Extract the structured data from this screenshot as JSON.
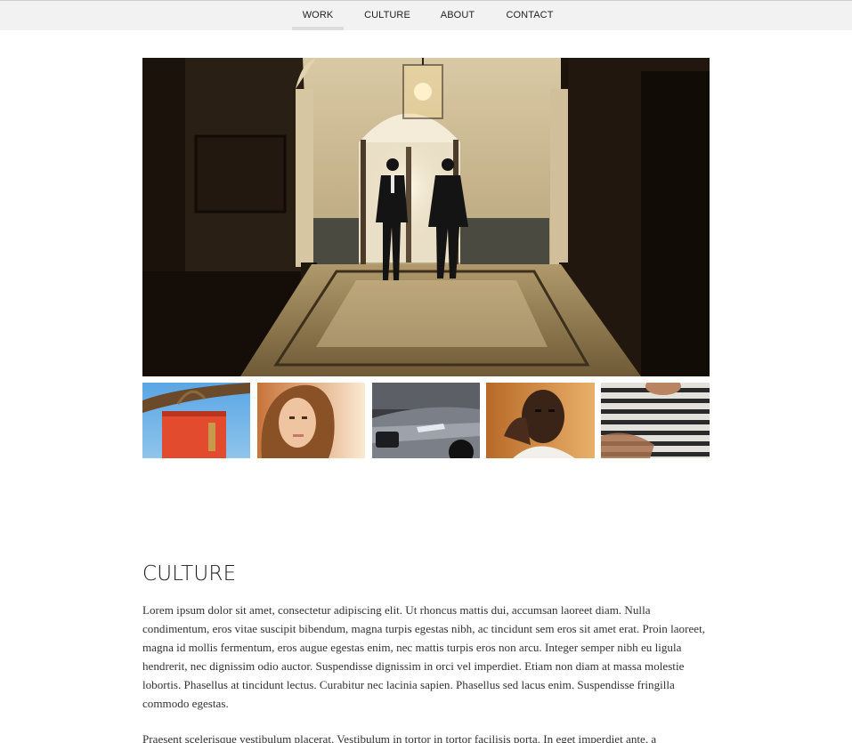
{
  "nav": {
    "items": [
      {
        "label": "WORK",
        "active": true
      },
      {
        "label": "CULTURE",
        "active": false
      },
      {
        "label": "ABOUT",
        "active": false
      },
      {
        "label": "CONTACT",
        "active": false
      }
    ]
  },
  "gallery": {
    "hero": {
      "subject": "two men in suits walking down a lit hallway"
    },
    "thumbnails": [
      {
        "subject": "red handbag hanging from tree branch"
      },
      {
        "subject": "woman with long hair in sunlight"
      },
      {
        "subject": "front of grey car"
      },
      {
        "subject": "man resting head on hand"
      },
      {
        "subject": "person in striped t-shirt"
      }
    ]
  },
  "culture": {
    "heading": "CULTURE",
    "paragraphs": [
      "Lorem ipsum dolor sit amet, consectetur adipiscing elit. Ut rhoncus mattis dui, accumsan laoreet diam. Nulla condimentum, eros vitae suscipit bibendum, magna turpis egestas nibh, ac tincidunt sem eros sit amet erat. Proin laoreet, magna id mollis fermentum, eros augue egestas enim, nec mattis turpis eros non arcu. Integer semper nibh eu ligula hendrerit, nec dignissim odio auctor. Suspendisse dignissim in orci vel imperdiet. Etiam non diam at massa molestie lobortis. Phasellus at tincidunt lectus. Curabitur nec lacinia sapien. Phasellus sed lacus enim. Suspendisse fringilla commodo egestas.",
      "Praesent scelerisque vestibulum placerat. Vestibulum in tortor in tortor facilisis porta. In eget imperdiet ante, a"
    ]
  },
  "colors": {
    "nav_background": "#f2f2f2",
    "nav_active_indicator": "#dcdcdc",
    "heading_text": "#1c1c1c",
    "body_text": "#333333"
  }
}
